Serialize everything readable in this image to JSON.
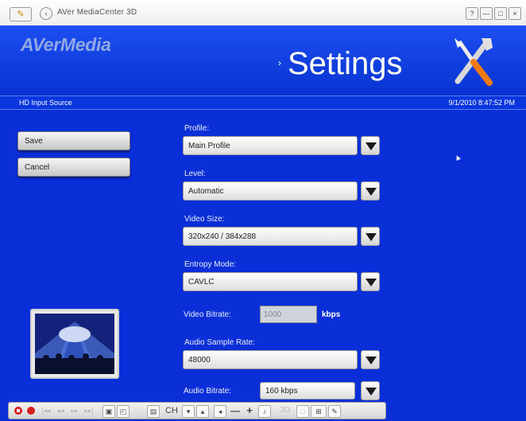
{
  "window": {
    "title": "AVer MediaCenter 3D",
    "controls": {
      "help": "?",
      "minimize": "—",
      "restore": "□",
      "close": "×"
    }
  },
  "header": {
    "brand": "AVerMedia",
    "arrow": "›",
    "title": "Settings",
    "icon": "tools-icon"
  },
  "status": {
    "source": "HD Input Source",
    "datetime": "9/1/2010 8:47:52 PM"
  },
  "sidebar": {
    "save_label": "Save",
    "cancel_label": "Cancel"
  },
  "form": {
    "profile": {
      "label": "Profile:",
      "value": "Main Profile"
    },
    "level": {
      "label": "Level:",
      "value": "Automatic"
    },
    "video_size": {
      "label": "Video Size:",
      "value": "320x240 / 384x288"
    },
    "entropy_mode": {
      "label": "Entropy Mode:",
      "value": "CAVLC"
    },
    "video_bitrate": {
      "label": "Video Bitrate:",
      "value": "1000",
      "unit": "kbps"
    },
    "audio_sample_rate": {
      "label": "Audio Sample Rate:",
      "value": "48000"
    },
    "audio_bitrate": {
      "label": "Audio Bitrate:",
      "value": "160 kbps"
    }
  },
  "toolbar": {
    "channel_label": "CH",
    "mode_3d_label": "3D",
    "volume_minus": "—",
    "volume_plus": "+"
  },
  "colors": {
    "background": "#0a2fd8",
    "header": "#1e4ef2",
    "brand": "#8fa8e6",
    "record": "#d81e1e"
  }
}
